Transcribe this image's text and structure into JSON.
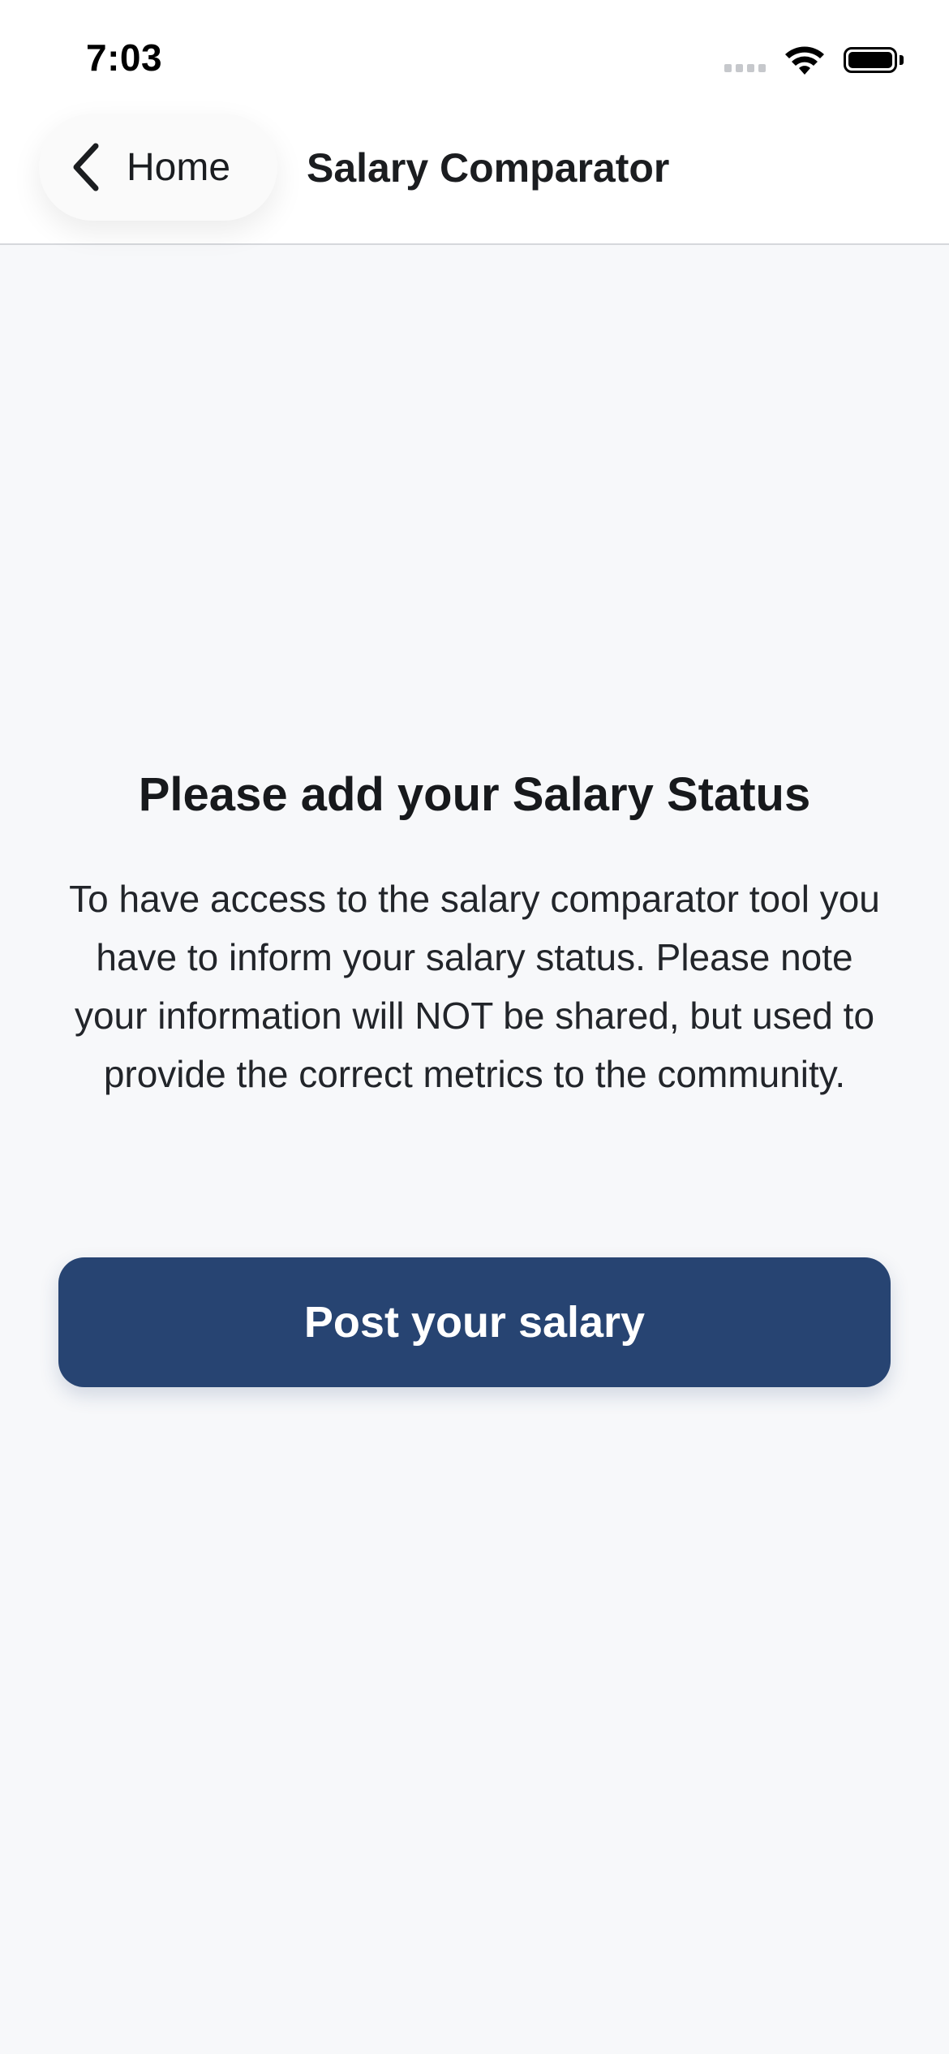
{
  "status_bar": {
    "time": "7:03",
    "icons": [
      "cellular-signal-icon",
      "wifi-icon",
      "battery-icon"
    ]
  },
  "nav": {
    "back_label": "Home",
    "back_icon": "chevron-left-icon",
    "title": "Salary Comparator"
  },
  "main": {
    "heading": "Please add your Salary Status",
    "body": "To have access to the salary comparator tool you have to inform your salary status. Please note your information will NOT be shared, but used to provide the correct metrics to the community.",
    "button_label": "Post your salary"
  },
  "colors": {
    "primary": "#274472",
    "background": "#f7f8fa",
    "topbar": "#ffffff"
  }
}
